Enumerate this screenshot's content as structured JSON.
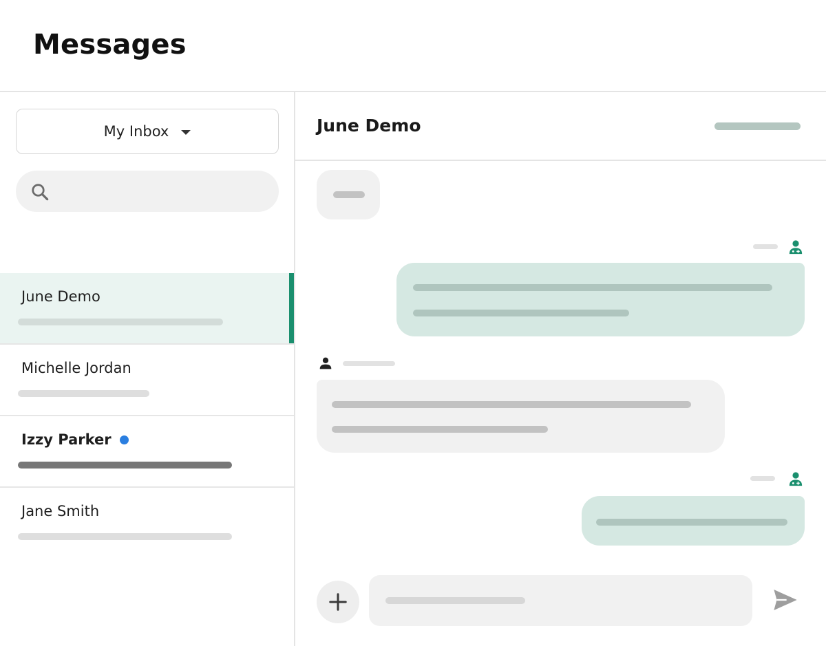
{
  "header": {
    "title": "Messages"
  },
  "sidebar": {
    "inbox_selector": {
      "label": "My Inbox"
    },
    "search": {
      "placeholder": ""
    },
    "conversations": [
      {
        "name": "June Demo",
        "unread": false,
        "active": true
      },
      {
        "name": "Michelle Jordan",
        "unread": false,
        "active": false
      },
      {
        "name": "Izzy Parker",
        "unread": true,
        "active": false
      },
      {
        "name": "Jane Smith",
        "unread": false,
        "active": false
      }
    ]
  },
  "chat": {
    "title": "June Demo",
    "composer": {
      "placeholder": ""
    }
  },
  "icons": {
    "search": "search-icon",
    "caret": "caret-down-icon",
    "provider": "doctor-icon",
    "patient": "person-icon",
    "add": "plus-icon",
    "send": "send-icon"
  },
  "colors": {
    "accent": "#1a8f6e",
    "active_row": "#eaf4f1",
    "outgoing_bubble": "#d5e8e2",
    "incoming_bubble": "#f1f1f1",
    "unread_dot": "#2a7ee0"
  }
}
